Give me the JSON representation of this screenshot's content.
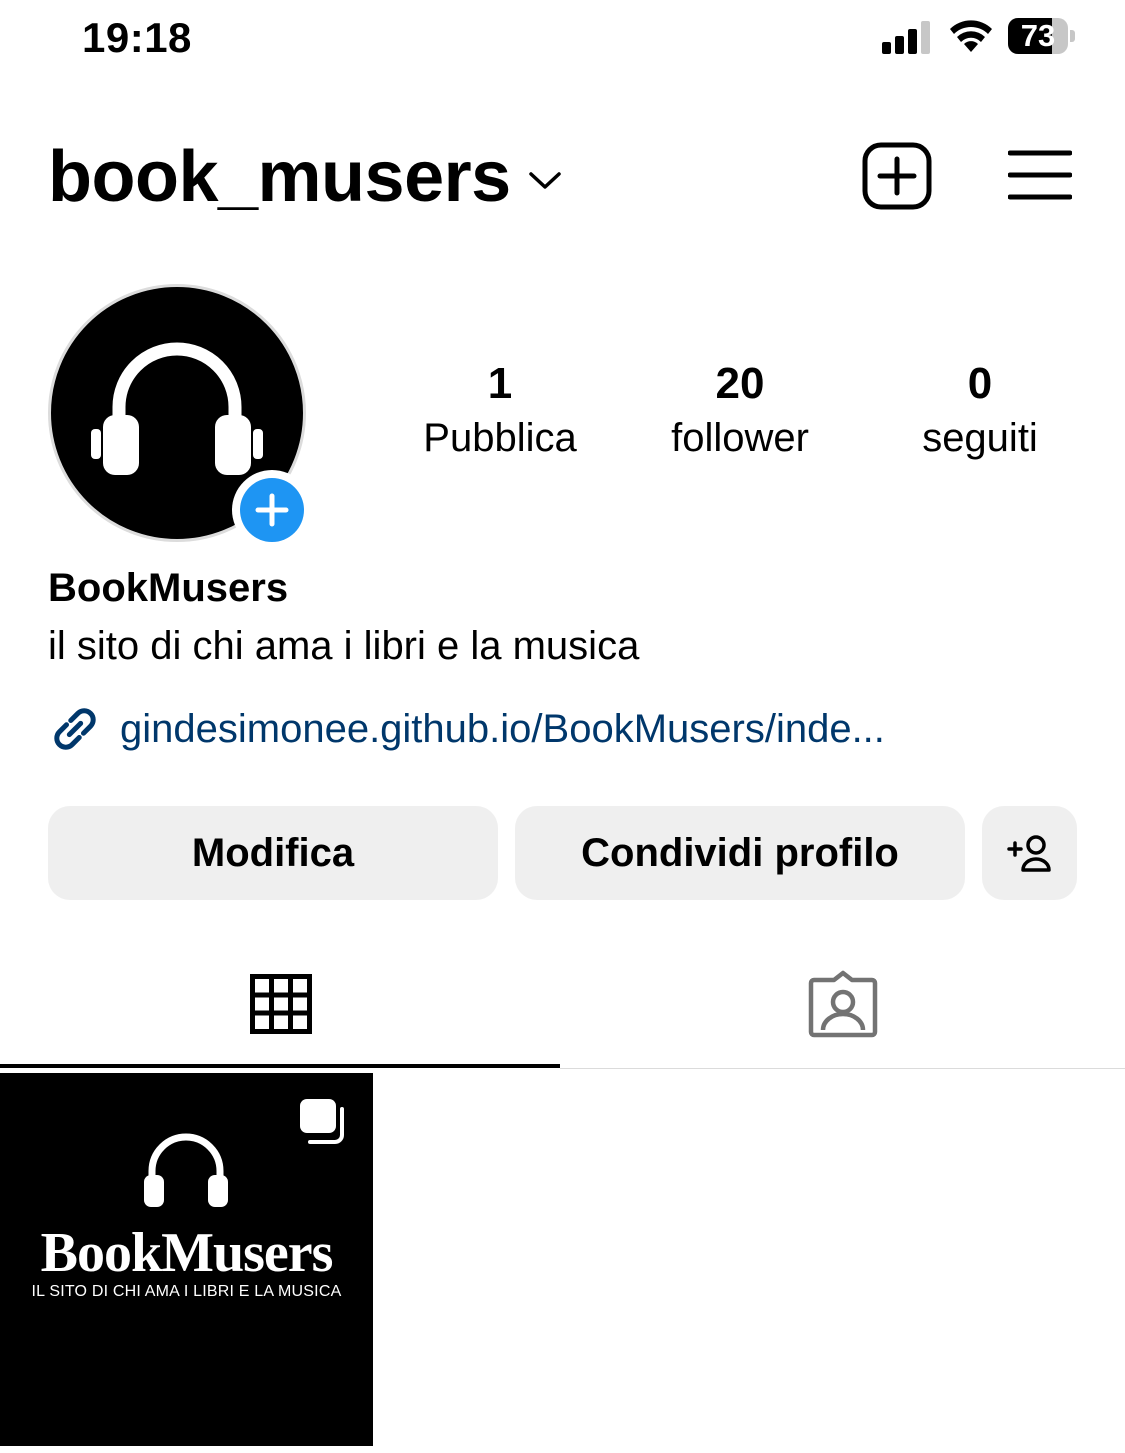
{
  "status_bar": {
    "time": "19:18",
    "battery_level": "73",
    "battery_fraction": 0.73,
    "icons": [
      "signal-icon",
      "wifi-icon",
      "battery-icon"
    ]
  },
  "header": {
    "username": "book_musers",
    "icons": [
      "chevron-down-icon",
      "add-post-icon",
      "menu-icon"
    ]
  },
  "profile": {
    "avatar_icon": "headphones-icon",
    "add_story_icon": "plus-icon",
    "stats": {
      "posts": {
        "count": "1",
        "label": "Pubblica"
      },
      "followers": {
        "count": "20",
        "label": "follower"
      },
      "following": {
        "count": "0",
        "label": "seguiti"
      }
    },
    "display_name": "BookMusers",
    "bio": "il sito di chi ama i libri e la musica",
    "link": "gindesimonee.github.io/BookMusers/inde..."
  },
  "actions": {
    "edit_label": "Modifica",
    "share_label": "Condividi profilo",
    "discover_icon": "add-person-icon"
  },
  "tabs": [
    {
      "name": "grid",
      "icon": "grid-icon",
      "active": true
    },
    {
      "name": "tagged",
      "icon": "tagged-icon",
      "active": false
    }
  ],
  "posts": [
    {
      "title": "BookMusers",
      "subtitle": "IL SITO DI CHI AMA I LIBRI E LA MUSICA",
      "multi_icon": "carousel-icon"
    }
  ],
  "colors": {
    "accent_blue": "#1e95f3",
    "link": "#00376b",
    "button_bg": "#efefef"
  }
}
